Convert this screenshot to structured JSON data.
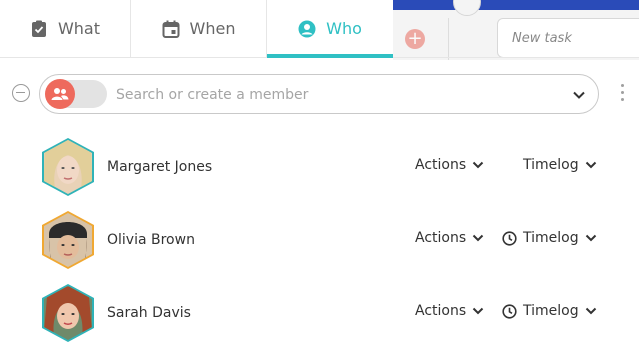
{
  "tabs": [
    {
      "label": "What",
      "icon": "clipboard-check-icon"
    },
    {
      "label": "When",
      "icon": "calendar-icon"
    },
    {
      "label": "Who",
      "icon": "user-circle-icon",
      "active": true
    }
  ],
  "background": {
    "new_task_placeholder": "New task"
  },
  "search": {
    "placeholder": "Search or create a member",
    "toggle_icon": "group-icon"
  },
  "members": [
    {
      "name": "Margaret Jones",
      "actions_label": "Actions",
      "timelog_label": "Timelog",
      "timelog_has_clock": false,
      "ring_color": "#2fb3b8"
    },
    {
      "name": "Olivia Brown",
      "actions_label": "Actions",
      "timelog_label": "Timelog",
      "timelog_has_clock": true,
      "ring_color": "#f0a832"
    },
    {
      "name": "Sarah Davis",
      "actions_label": "Actions",
      "timelog_label": "Timelog",
      "timelog_has_clock": true,
      "ring_color": "#2fb3b8"
    }
  ],
  "colors": {
    "accent": "#2fc0c4",
    "toggle_knob": "#ee6a5d",
    "blue_bar": "#2a4bb8"
  }
}
